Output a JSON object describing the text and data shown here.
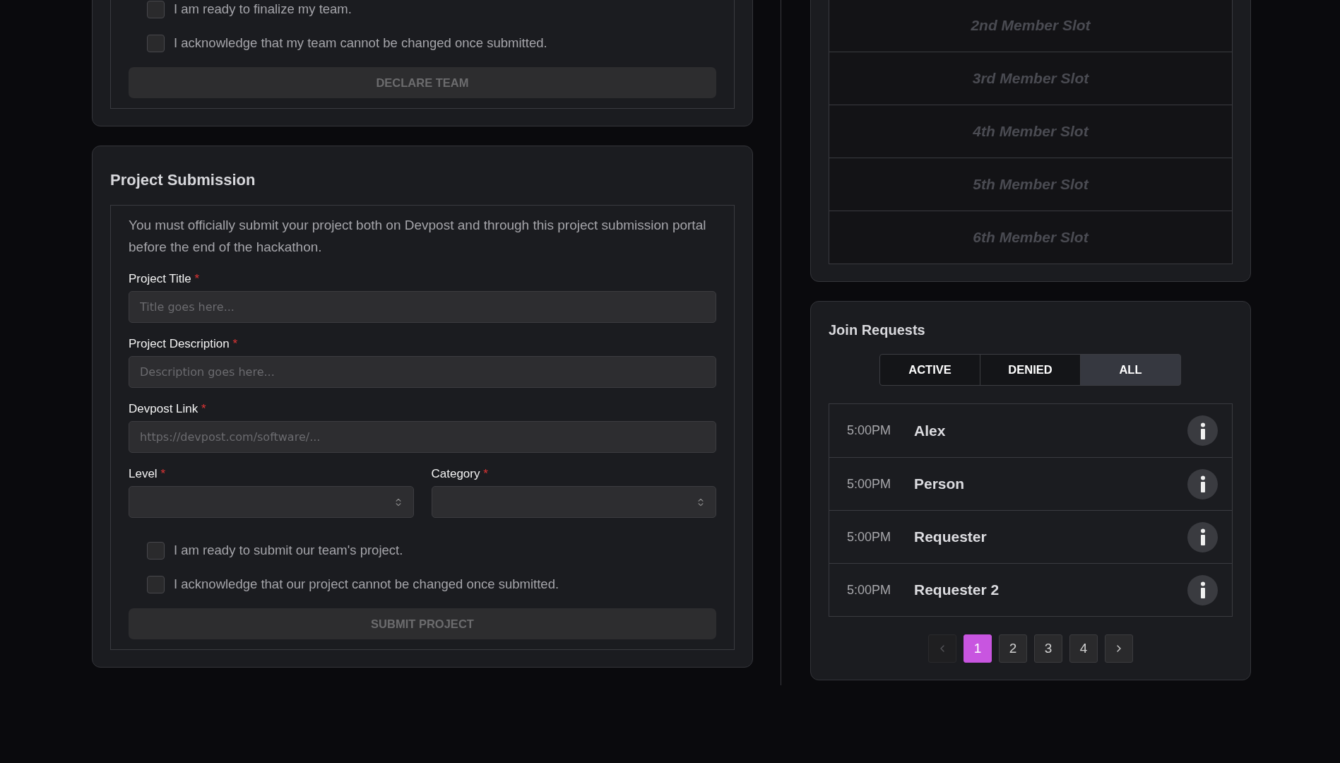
{
  "team_card": {
    "checkboxes": [
      {
        "label": "I am ready to finalize my team.",
        "checked": false
      },
      {
        "label": "I acknowledge that my team cannot be changed once submitted.",
        "checked": false
      }
    ],
    "button": {
      "label": "DECLARE TEAM",
      "disabled": true
    }
  },
  "project_submission": {
    "title": "Project Submission",
    "intro": "You must officially submit your project both on Devpost and through this project submission portal before the end of the hackathon.",
    "fields": [
      {
        "label": "Project Title",
        "required_mark": "*",
        "placeholder": "Title goes here..."
      },
      {
        "label": "Project Description",
        "required_mark": "*",
        "placeholder": "Description goes here..."
      },
      {
        "label": "Devpost Link",
        "required_mark": "*",
        "placeholder": "https://devpost.com/software/..."
      }
    ],
    "selects": [
      {
        "label": "Level",
        "required_mark": "*"
      },
      {
        "label": "Category",
        "required_mark": "*"
      }
    ],
    "checkboxes": [
      {
        "label": "I am ready to submit our team's project.",
        "checked": false
      },
      {
        "label": "I acknowledge that our project cannot be changed once submitted.",
        "checked": false
      }
    ],
    "button": {
      "label": "SUBMIT PROJECT",
      "disabled": true
    }
  },
  "member_slots": [
    "2nd Member Slot",
    "3rd Member Slot",
    "4th Member Slot",
    "5th Member Slot",
    "6th Member Slot"
  ],
  "join_requests": {
    "title": "Join Requests",
    "tabs": [
      {
        "label": "ACTIVE",
        "selected": false
      },
      {
        "label": "DENIED",
        "selected": false
      },
      {
        "label": "ALL",
        "selected": true
      }
    ],
    "requests": [
      {
        "time": "5:00PM",
        "name": "Alex"
      },
      {
        "time": "5:00PM",
        "name": "Person"
      },
      {
        "time": "5:00PM",
        "name": "Requester"
      },
      {
        "time": "5:00PM",
        "name": "Requester 2"
      }
    ],
    "pagination": {
      "prev_disabled": true,
      "next_disabled": false,
      "pages": [
        {
          "label": "1",
          "selected": true
        },
        {
          "label": "2",
          "selected": false
        },
        {
          "label": "3",
          "selected": false
        },
        {
          "label": "4",
          "selected": false
        }
      ]
    }
  }
}
